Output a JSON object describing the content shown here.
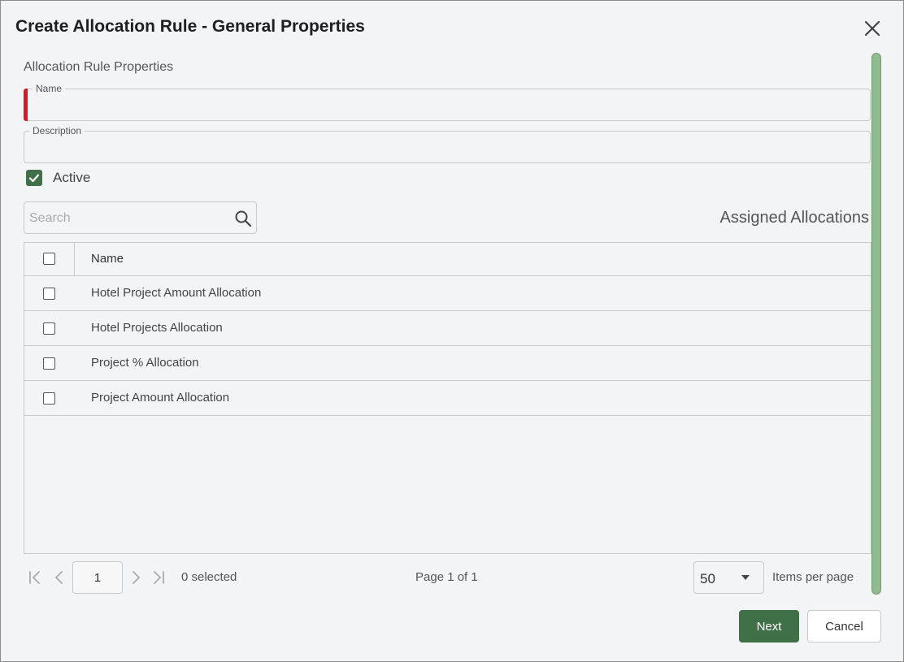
{
  "dialog": {
    "title": "Create Allocation Rule - General Properties"
  },
  "form": {
    "section_title": "Allocation Rule Properties",
    "name_label": "Name",
    "name_value": "",
    "description_label": "Description",
    "description_value": "",
    "active_label": "Active",
    "active_checked": true
  },
  "search": {
    "placeholder": "Search"
  },
  "assigned": {
    "title": "Assigned Allocations"
  },
  "grid": {
    "columns": [
      "Name"
    ],
    "rows": [
      {
        "name": "Hotel Project Amount Allocation",
        "checked": false
      },
      {
        "name": "Hotel Projects Allocation",
        "checked": false
      },
      {
        "name": "Project % Allocation",
        "checked": false
      },
      {
        "name": "Project Amount Allocation",
        "checked": false
      }
    ]
  },
  "pager": {
    "page_value": "1",
    "selected_text": "0 selected",
    "page_of_text": "Page 1 of 1",
    "per_page_value": "50",
    "per_page_label": "Items per page"
  },
  "buttons": {
    "next_label": "Next",
    "cancel_label": "Cancel"
  },
  "colors": {
    "primary": "#3f7048",
    "required_marker": "#e8111c",
    "scrollbar": "#8fbc8f"
  }
}
